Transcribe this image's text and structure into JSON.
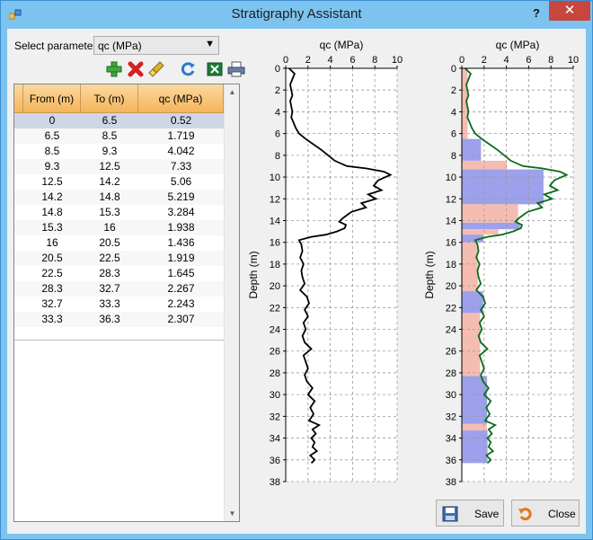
{
  "window": {
    "title": "Stratigraphy Assistant",
    "help_label": "?",
    "close_label": "✕"
  },
  "parameter": {
    "label": "Select parameter:",
    "selected": "qc (MPa)"
  },
  "toolbar": [
    "add-icon",
    "delete-icon",
    "clear-icon",
    "refresh-icon",
    "excel-icon",
    "print-icon"
  ],
  "table": {
    "columns": [
      "From (m)",
      "To (m)",
      "qc (MPa)"
    ],
    "rows": [
      [
        "0",
        "6.5",
        "0.52"
      ],
      [
        "6.5",
        "8.5",
        "1.719"
      ],
      [
        "8.5",
        "9.3",
        "4.042"
      ],
      [
        "9.3",
        "12.5",
        "7.33"
      ],
      [
        "12.5",
        "14.2",
        "5.06"
      ],
      [
        "14.2",
        "14.8",
        "5.219"
      ],
      [
        "14.8",
        "15.3",
        "3.284"
      ],
      [
        "15.3",
        "16",
        "1.938"
      ],
      [
        "16",
        "20.5",
        "1.436"
      ],
      [
        "20.5",
        "22.5",
        "1.919"
      ],
      [
        "22.5",
        "28.3",
        "1.645"
      ],
      [
        "28.3",
        "32.7",
        "2.267"
      ],
      [
        "32.7",
        "33.3",
        "2.243"
      ],
      [
        "33.3",
        "36.3",
        "2.307"
      ]
    ]
  },
  "buttons": {
    "save": "Save",
    "close": "Close"
  },
  "colors": {
    "layer_fill_a": "#f4b8ad",
    "layer_fill_b": "#8c8fe6",
    "profile_line": "#000000",
    "profile_line_right": "#0a6b1a",
    "header_fill": "#f5b45a"
  },
  "chart_data": [
    {
      "type": "line",
      "title": "qc (MPa)",
      "ylabel": "Depth (m)",
      "xlim": [
        0,
        10
      ],
      "ylim": [
        38,
        0
      ],
      "xticks": [
        "0",
        "2",
        "4",
        "6",
        "8",
        "10"
      ],
      "yticks": [
        "0",
        "2",
        "4",
        "6",
        "8",
        "10",
        "12",
        "14",
        "16",
        "18",
        "20",
        "22",
        "24",
        "26",
        "28",
        "30",
        "32",
        "34",
        "36",
        "38"
      ],
      "grid": true,
      "series": [
        {
          "x": [
            0.3,
            0.8,
            0.6,
            0.4,
            0.5,
            0.6,
            0.4,
            0.5,
            0.6,
            0.5,
            0.7,
            0.9,
            1.2,
            1.8,
            2.5,
            3.2,
            3.8,
            4.4,
            5.5,
            7.2,
            8.8,
            9.4,
            8.3,
            7.9,
            8.6,
            7.4,
            8.1,
            6.8,
            7.2,
            5.9,
            5.5,
            5.1,
            4.8,
            5.4,
            5.3,
            4.6,
            3.6,
            2.3,
            1.2,
            1.4,
            1.5,
            1.3,
            1.6,
            1.4,
            1.5,
            1.7,
            1.3,
            1.9,
            2.1,
            1.7,
            2.0,
            1.6,
            1.8,
            1.5,
            1.7,
            2.3,
            1.6,
            1.8,
            2.0,
            1.7,
            1.9,
            2.4,
            2.0,
            2.6,
            2.2,
            2.5,
            2.1,
            3.0,
            2.4,
            2.7,
            2.3,
            2.6,
            2.4,
            2.8,
            2.2,
            2.6,
            2.4,
            2.3
          ],
          "y": [
            0,
            0.5,
            1,
            1.5,
            2,
            2.5,
            3,
            3.5,
            4,
            4.5,
            5,
            5.5,
            6,
            6.5,
            7,
            7.5,
            8,
            8.5,
            9,
            9.2,
            9.5,
            9.8,
            10.3,
            10.8,
            11.2,
            11.6,
            12,
            12.4,
            12.8,
            13.2,
            13.5,
            13.8,
            14.1,
            14.4,
            14.7,
            15,
            15.3,
            15.5,
            15.8,
            16.2,
            16.8,
            17.4,
            18,
            18.6,
            19.2,
            19.8,
            20.4,
            21,
            21.6,
            22.2,
            22.8,
            23.4,
            24,
            24.6,
            25.2,
            25.8,
            26.4,
            27,
            27.6,
            28.2,
            28.8,
            29.4,
            30,
            30.6,
            31.2,
            31.8,
            32.4,
            32.8,
            33.2,
            33.6,
            34,
            34.4,
            34.8,
            35.2,
            35.6,
            36,
            36.2,
            36.3
          ]
        }
      ]
    },
    {
      "type": "area",
      "title": "qc (MPa)",
      "ylabel": "Depth (m)",
      "xlim": [
        0,
        10
      ],
      "ylim": [
        38,
        0
      ],
      "xticks": [
        "0",
        "2",
        "4",
        "6",
        "8",
        "10"
      ],
      "yticks": [
        "0",
        "2",
        "4",
        "6",
        "8",
        "10",
        "12",
        "14",
        "16",
        "18",
        "20",
        "22",
        "24",
        "26",
        "28",
        "30",
        "32",
        "34",
        "36",
        "38"
      ],
      "grid": true,
      "layers": [
        {
          "from": 0,
          "to": 6.5,
          "qc": 0.52
        },
        {
          "from": 6.5,
          "to": 8.5,
          "qc": 1.719
        },
        {
          "from": 8.5,
          "to": 9.3,
          "qc": 4.042
        },
        {
          "from": 9.3,
          "to": 12.5,
          "qc": 7.33
        },
        {
          "from": 12.5,
          "to": 14.2,
          "qc": 5.06
        },
        {
          "from": 14.2,
          "to": 14.8,
          "qc": 5.219
        },
        {
          "from": 14.8,
          "to": 15.3,
          "qc": 3.284
        },
        {
          "from": 15.3,
          "to": 16,
          "qc": 1.938
        },
        {
          "from": 16,
          "to": 20.5,
          "qc": 1.436
        },
        {
          "from": 20.5,
          "to": 22.5,
          "qc": 1.919
        },
        {
          "from": 22.5,
          "to": 28.3,
          "qc": 1.645
        },
        {
          "from": 28.3,
          "to": 32.7,
          "qc": 2.267
        },
        {
          "from": 32.7,
          "to": 33.3,
          "qc": 2.243
        },
        {
          "from": 33.3,
          "to": 36.3,
          "qc": 2.307
        }
      ]
    }
  ]
}
